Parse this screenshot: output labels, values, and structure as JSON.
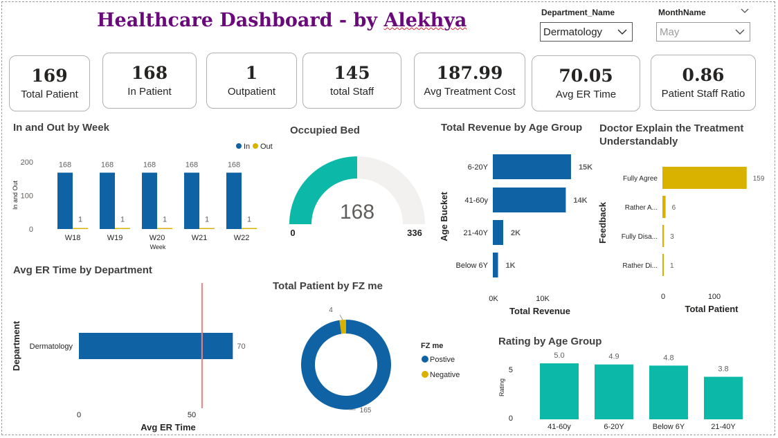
{
  "header": {
    "title_main": "Healthcare Dashboard - by ",
    "title_name": "Alekhya"
  },
  "filters": {
    "department": {
      "label": "Department_Name",
      "value": "Dermatology"
    },
    "month": {
      "label": "MonthName",
      "value": "May"
    }
  },
  "kpis": [
    {
      "value": "169",
      "label": "Total Patient"
    },
    {
      "value": "168",
      "label": "In Patient"
    },
    {
      "value": "1",
      "label": "Outpatient"
    },
    {
      "value": "145",
      "label": "total Staff"
    },
    {
      "value": "187.99",
      "label": "Avg Treatment Cost"
    },
    {
      "value": "70.05",
      "label": "Avg ER Time"
    },
    {
      "value": "0.86",
      "label": "Patient Staff Ratio"
    }
  ],
  "colors": {
    "blue": "#0f62a3",
    "teal": "#0cb8a8",
    "gold": "#d9b200",
    "grey": "#f2f1f0",
    "ref_line": "#f08080"
  },
  "chart_data": [
    {
      "id": "in_out_week",
      "type": "bar",
      "title": "In and Out by Week",
      "xlabel": "Week",
      "ylabel": "In and Out",
      "categories": [
        "W18",
        "W19",
        "W20",
        "W21",
        "W22"
      ],
      "series": [
        {
          "name": "In",
          "values": [
            168,
            168,
            168,
            168,
            168
          ]
        },
        {
          "name": "Out",
          "values": [
            1,
            1,
            1,
            1,
            1
          ]
        }
      ],
      "ylim": [
        0,
        200
      ],
      "yticks": [
        "0",
        "100",
        "200"
      ],
      "legend": "top-right"
    },
    {
      "id": "occupied_bed",
      "type": "gauge",
      "title": "Occupied Bed",
      "value": 168,
      "min": 0,
      "max": 336,
      "value_label": "168",
      "min_label": "0",
      "max_label": "336"
    },
    {
      "id": "revenue_age",
      "type": "bar",
      "title": "Total Revenue by Age Group",
      "xlabel": "Total Revenue",
      "ylabel": "Age Bucket",
      "categories": [
        "6-20Y",
        "41-60y",
        "21-40Y",
        "Below 6Y"
      ],
      "values": [
        15000,
        14000,
        2000,
        1000
      ],
      "data_labels": [
        "15K",
        "14K",
        "2K",
        "1K"
      ],
      "xticks": [
        "0K",
        "10K"
      ],
      "xlim": [
        0,
        17000
      ]
    },
    {
      "id": "doctor_explain",
      "type": "bar",
      "title": "Doctor Explain the Treatment Understandably",
      "xlabel": "Total Patient",
      "ylabel": "Feedback",
      "categories": [
        "Fully Agree",
        "Rather A...",
        "Fully Disa...",
        "Rather Di..."
      ],
      "values": [
        159,
        6,
        3,
        1
      ],
      "data_labels": [
        "159",
        "6",
        "3",
        "1"
      ],
      "xticks": [
        "0",
        "100"
      ],
      "xlim": [
        0,
        175
      ]
    },
    {
      "id": "er_time_dept",
      "type": "bar",
      "title": "Avg ER Time by Department",
      "xlabel": "Avg ER Time",
      "ylabel": "Department",
      "categories": [
        "Dermatology"
      ],
      "values": [
        70
      ],
      "data_labels": [
        "70"
      ],
      "reference_line": 56,
      "xticks": [
        "0",
        "50"
      ],
      "xlim": [
        0,
        85
      ]
    },
    {
      "id": "fz_me",
      "type": "pie",
      "title": "Total Patient by FZ me",
      "legend_title": "FZ me",
      "categories": [
        "Postive",
        "Negative"
      ],
      "values": [
        165,
        4
      ],
      "data_labels": [
        "165",
        "4"
      ]
    },
    {
      "id": "rating_age",
      "type": "bar",
      "title": "Rating by Age Group",
      "ylabel": "Rating",
      "categories": [
        "41-60y",
        "6-20Y",
        "Below 6Y",
        "21-40Y"
      ],
      "values": [
        5.0,
        4.9,
        4.8,
        3.8
      ],
      "data_labels": [
        "5.0",
        "4.9",
        "4.8",
        "3.8"
      ],
      "yticks": [
        "0",
        "5"
      ],
      "ylim": [
        0,
        6.8
      ]
    }
  ]
}
